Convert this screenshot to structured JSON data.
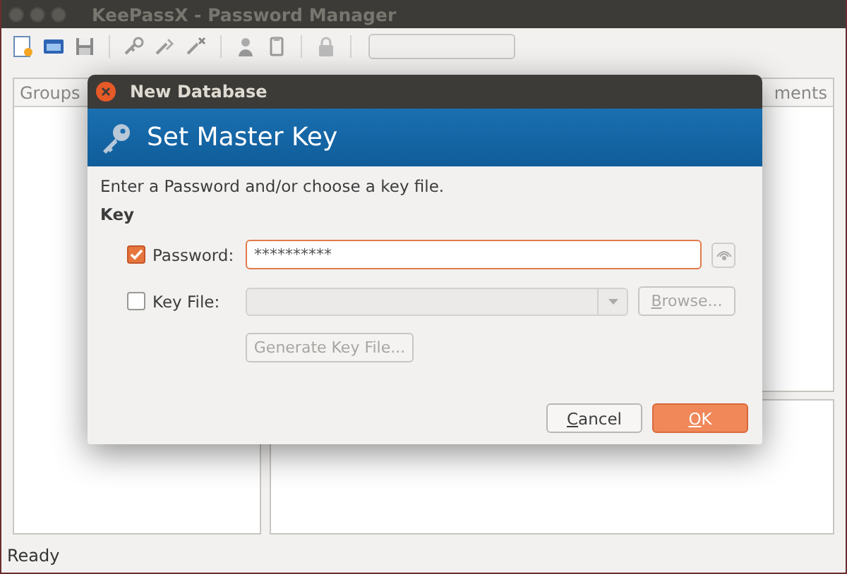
{
  "window": {
    "title": "KeePassX - Password Manager"
  },
  "panels": {
    "groups_header": "Groups",
    "column_header": "ments"
  },
  "status_bar": "Ready",
  "dialog": {
    "title": "New Database",
    "banner": "Set Master Key",
    "intro": "Enter a Password and/or choose a key file.",
    "section": "Key",
    "password": {
      "label": "Password:",
      "checked": true,
      "value": "**********"
    },
    "key_file": {
      "label": "Key File:",
      "checked": false,
      "disabled": true,
      "browse": "Browse...",
      "generate": "Generate Key File..."
    },
    "buttons": [
      {
        "label": "Cancel",
        "kind": "secondary"
      },
      {
        "label": "OK",
        "kind": "primary"
      }
    ]
  }
}
